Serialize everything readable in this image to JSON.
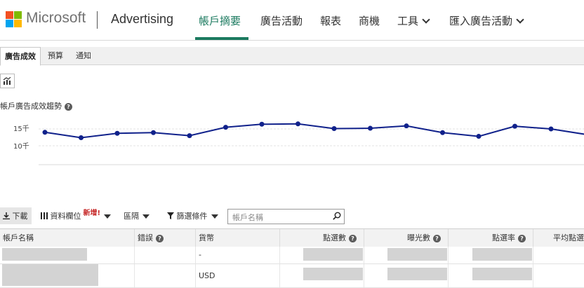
{
  "brand": {
    "company": "Microsoft",
    "product": "Advertising",
    "logo_colors": [
      "#f25022",
      "#7fba00",
      "#00a4ef",
      "#ffb900"
    ]
  },
  "nav": {
    "items": [
      {
        "label": "帳戶摘要",
        "active": true
      },
      {
        "label": "廣告活動"
      },
      {
        "label": "報表"
      },
      {
        "label": "商機"
      },
      {
        "label": "工具",
        "has_dropdown": true
      },
      {
        "label": "匯入廣告活動",
        "has_dropdown": true
      }
    ],
    "accent_color": "#1b7a5f"
  },
  "subtabs": [
    {
      "label": "廣告成效",
      "active": true
    },
    {
      "label": "預算"
    },
    {
      "label": "通知"
    }
  ],
  "chart_toggle_icon": "chart-icon",
  "trend": {
    "title": "帳戶廣告成效趨勢",
    "help_icon": "help-icon"
  },
  "chart_data": {
    "type": "line",
    "title": "",
    "xlabel": "",
    "ylabel": "",
    "y_ticks": [
      "15千",
      "10千"
    ],
    "ylim": [
      0,
      25000
    ],
    "grid": true,
    "series": [
      {
        "color": "#10218b",
        "values": [
          14000,
          12400,
          13700,
          13900,
          13000,
          15500,
          16400,
          16500,
          15100,
          15200,
          15900,
          13900,
          12800,
          15800,
          15000,
          13300
        ]
      }
    ]
  },
  "toolbar": {
    "download": "下載",
    "columns": "資料欄位",
    "new_badge": "新增!",
    "segment": "區隔",
    "filter": "篩選條件",
    "search_placeholder": "帳戶名稱"
  },
  "table": {
    "columns": [
      "帳戶名稱",
      "錯誤",
      "貨幣",
      "點選數",
      "曝光數",
      "點選率",
      "平均點選成本"
    ],
    "rows": [
      {
        "currency": "-"
      },
      {
        "currency": "USD"
      }
    ]
  }
}
